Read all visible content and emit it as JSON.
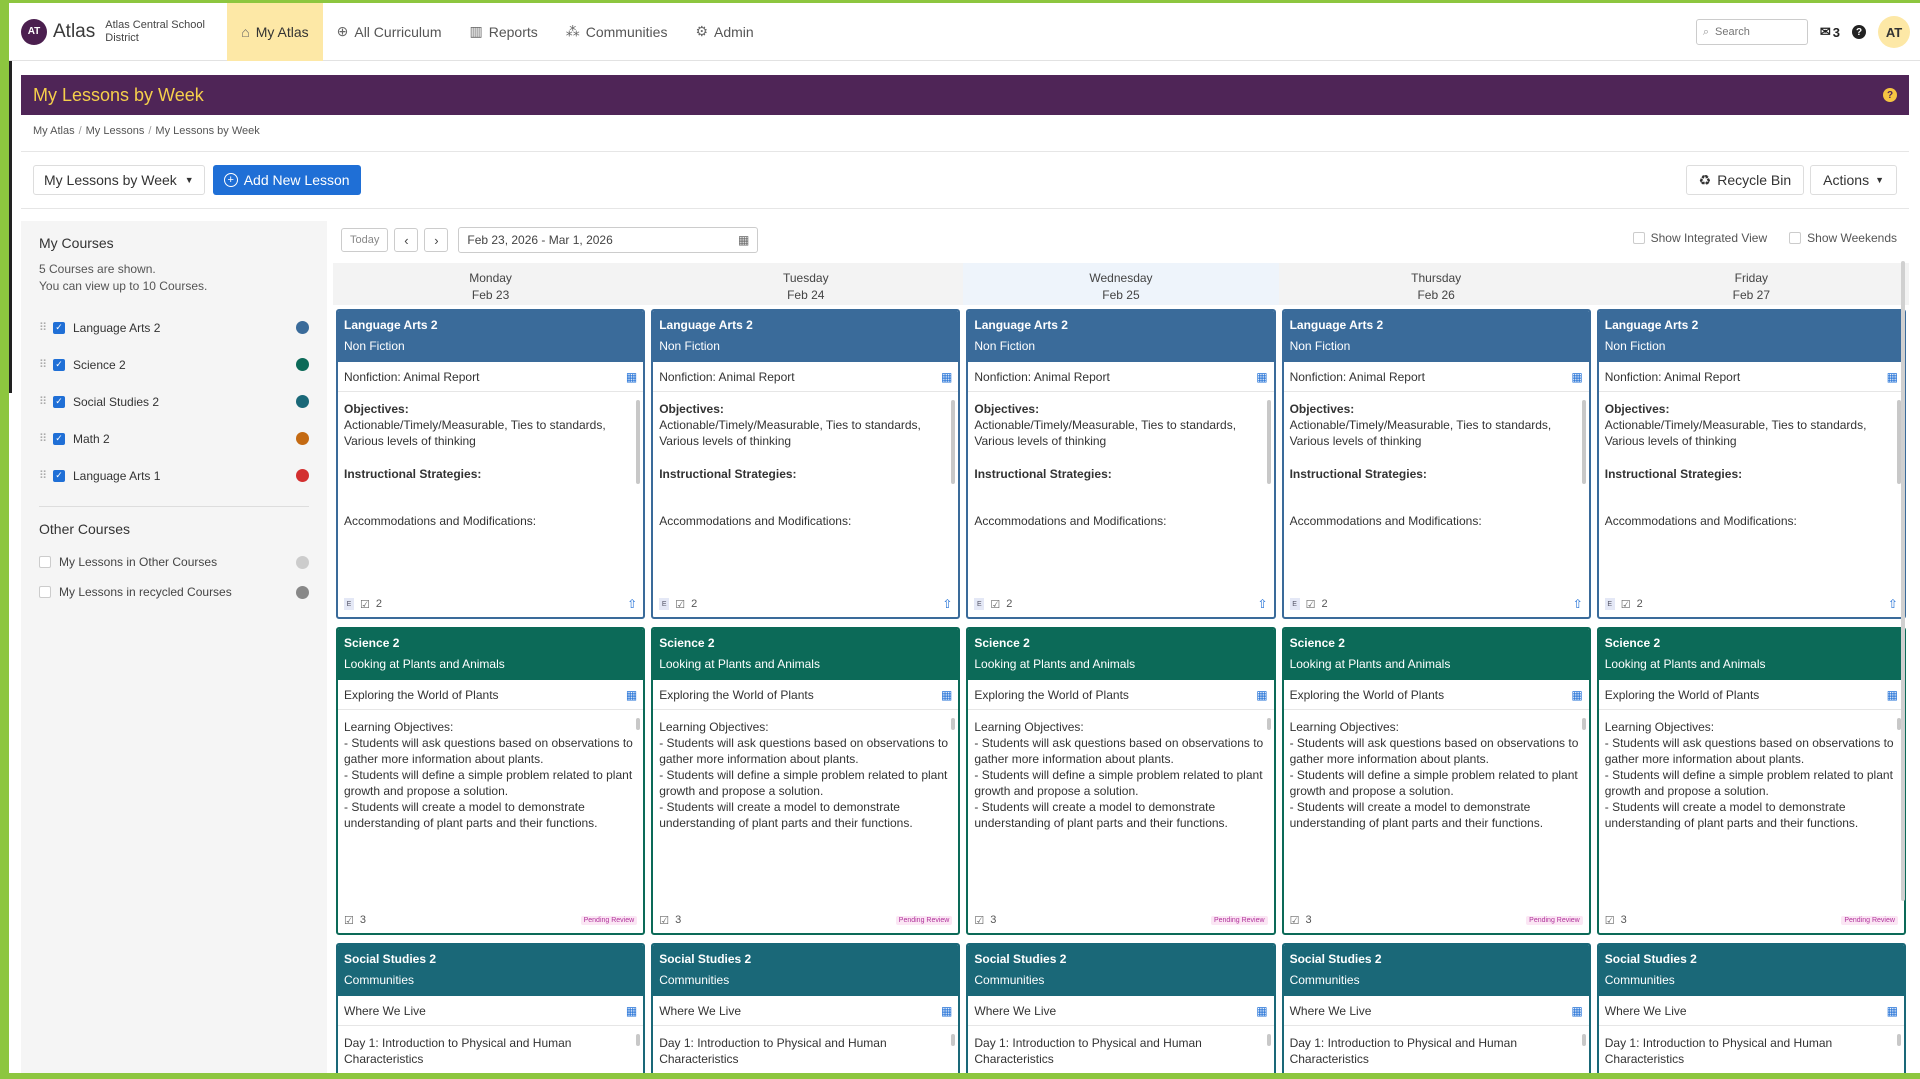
{
  "nav": {
    "logo_initials": "AT",
    "logo_text": "Atlas",
    "district": "Atlas Central School District",
    "items": [
      {
        "label": "My Atlas",
        "icon": "home-icon",
        "active": true
      },
      {
        "label": "All Curriculum",
        "icon": "globe-icon",
        "active": false
      },
      {
        "label": "Reports",
        "icon": "chart-icon",
        "active": false
      },
      {
        "label": "Communities",
        "icon": "network-icon",
        "active": false
      },
      {
        "label": "Admin",
        "icon": "gear-icon",
        "active": false
      }
    ],
    "search_placeholder": "Search",
    "mail_count": "3",
    "help": "?",
    "avatar": "AT"
  },
  "page": {
    "title": "My Lessons by Week",
    "help": "?",
    "breadcrumb": [
      "My Atlas",
      "My Lessons",
      "My Lessons by Week"
    ]
  },
  "toolbar": {
    "view_select": "My Lessons by Week",
    "add_lesson": "Add New Lesson",
    "recycle_bin": "Recycle Bin",
    "actions": "Actions"
  },
  "sidebar": {
    "my_courses_title": "My Courses",
    "shown_text": "5 Courses are shown.",
    "limit_text": "You can view up to 10 Courses.",
    "courses": [
      {
        "label": "Language Arts 2",
        "color": "#3a6b9a"
      },
      {
        "label": "Science 2",
        "color": "#0c6a58"
      },
      {
        "label": "Social Studies 2",
        "color": "#1a6878"
      },
      {
        "label": "Math 2",
        "color": "#c46a12"
      },
      {
        "label": "Language Arts 1",
        "color": "#d32f2f"
      }
    ],
    "other_title": "Other Courses",
    "other": [
      {
        "label": "My Lessons in Other Courses",
        "color": "#cccccc"
      },
      {
        "label": "My Lessons in recycled Courses",
        "color": "#888888"
      }
    ]
  },
  "calendar": {
    "today": "Today",
    "prev": "‹",
    "next": "›",
    "range": "Feb 23, 2026 - Mar 1, 2026",
    "show_integrated": "Show Integrated View",
    "show_weekends": "Show Weekends",
    "days": [
      {
        "name": "Monday",
        "date": "Feb 23"
      },
      {
        "name": "Tuesday",
        "date": "Feb 24"
      },
      {
        "name": "Wednesday",
        "date": "Feb 25"
      },
      {
        "name": "Thursday",
        "date": "Feb 26"
      },
      {
        "name": "Friday",
        "date": "Feb 27"
      }
    ]
  },
  "cards": {
    "la": {
      "course": "Language Arts 2",
      "unit": "Non Fiction",
      "lesson": "Nonfiction: Animal Report",
      "objectives_label": "Objectives:",
      "objectives": "Actionable/Timely/Measurable, Ties to standards, Various levels of thinking",
      "strategies_label": "Instructional Strategies:",
      "accommodations_label": "Accommodations and Modifications:",
      "tag": "E",
      "count": "2"
    },
    "sci": {
      "course": "Science 2",
      "unit": "Looking at Plants and Animals",
      "lesson": "Exploring the World of Plants",
      "objectives_label": "Learning Objectives:",
      "lines": [
        "- Students will ask questions based on observations to gather more information about plants.",
        "- Students will define a simple problem related to plant growth and propose a solution.",
        "- Students will create a model to demonstrate understanding of plant parts and their functions."
      ],
      "count": "3",
      "status": "Pending Review"
    },
    "ss": {
      "course": "Social Studies 2",
      "unit": "Communities",
      "lesson": "Where We Live",
      "text": "Day 1: Introduction to Physical and Human Characteristics"
    }
  }
}
